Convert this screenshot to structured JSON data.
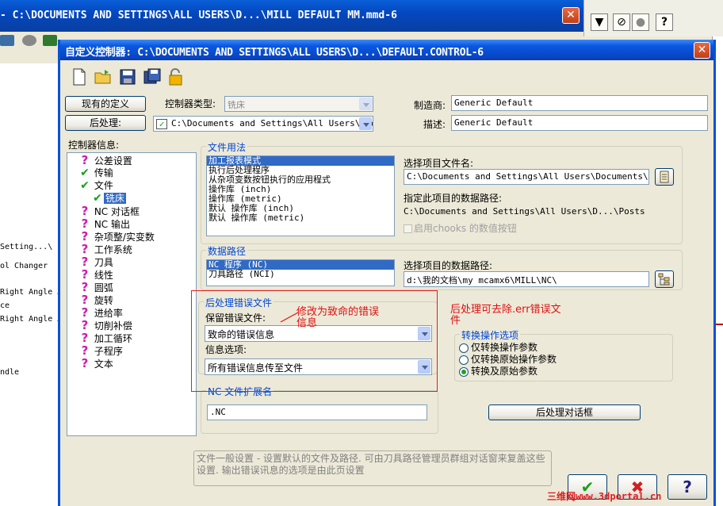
{
  "parent_window": {
    "title": "- C:\\DOCUMENTS AND SETTINGS\\ALL USERS\\D...\\MILL DEFAULT MM.mmd-6",
    "close": "✕",
    "left_lines": [
      "Setting...\\",
      "ol Changer",
      "Right Angle A",
      "ce",
      "Right Angle A",
      "ndle"
    ],
    "right_toolbar_icons": [
      "▼",
      "⊘",
      "●",
      "?"
    ]
  },
  "dialog": {
    "title": "自定义控制器: C:\\DOCUMENTS AND SETTINGS\\ALL USERS\\D...\\DEFAULT.CONTROL-6",
    "close": "✕",
    "toolbar_icons": [
      "new-file-icon",
      "open-folder-icon",
      "save-icon",
      "save-as-icon",
      "lock-icon"
    ],
    "btn_existing": "现有的定义",
    "btn_post": "后处理:",
    "controller_type_label": "控制器类型:",
    "controller_type_value": "铣床",
    "post_path": "C:\\Documents and Settings\\All Users\\Docu",
    "manufacturer_label": "制造商:",
    "manufacturer_value": "Generic Default",
    "description_label": "描述:",
    "description_value": "Generic Default",
    "tree_label": "控制器信息:",
    "tree": [
      {
        "mark": "?",
        "label": "公差设置"
      },
      {
        "mark": "✔",
        "label": "传输"
      },
      {
        "mark": "✔",
        "label": "文件"
      },
      {
        "mark": "✔",
        "label": "铣床",
        "child": true
      },
      {
        "mark": "?",
        "label": "NC 对话框"
      },
      {
        "mark": "?",
        "label": "NC 输出"
      },
      {
        "mark": "?",
        "label": "杂项整/实变数"
      },
      {
        "mark": "?",
        "label": "工作系统"
      },
      {
        "mark": "?",
        "label": "刀具"
      },
      {
        "mark": "?",
        "label": "线性"
      },
      {
        "mark": "?",
        "label": "圆弧"
      },
      {
        "mark": "?",
        "label": "旋转"
      },
      {
        "mark": "?",
        "label": "进给率"
      },
      {
        "mark": "?",
        "label": "切削补偿"
      },
      {
        "mark": "?",
        "label": "加工循环"
      },
      {
        "mark": "?",
        "label": "子程序"
      },
      {
        "mark": "?",
        "label": "文本"
      }
    ],
    "file_usage": {
      "title": "文件用法",
      "items": [
        "加工报表模式",
        "执行后处理程序",
        "从杂项变数按钮执行的应用程式",
        "操作库 (inch)",
        "操作库 (metric)",
        "默认 操作库 (inch)",
        "默认 操作库 (metric)"
      ],
      "select_file_label": "选择项目文件名:",
      "select_file_value": "C:\\Documents and Settings\\All Users\\Documents\\share",
      "data_path_label": "指定此项目的数据路径:",
      "data_path_value": "C:\\Documents and Settings\\All Users\\D...\\Posts",
      "chooks_label": "启用chooks 的数值按钮"
    },
    "data_path": {
      "title": "数据路径",
      "items": [
        "NC 程序 (NC)",
        "刀具路径 (NCI)"
      ],
      "select_path_label": "选择项目的数据路径:",
      "select_path_value": "d:\\我的文档\\my mcamx6\\MILL\\NC\\"
    },
    "post_error": {
      "title": "后处理错误文件",
      "keep_label": "保留错误文件:",
      "keep_value": "致命的错误信息",
      "info_label": "信息选项:",
      "info_value": "所有错误信息传至文件"
    },
    "convert_ops": {
      "title": "转换操作选项",
      "options": [
        "仅转换操作参数",
        "仅转换原始操作参数",
        "转换及原始参数"
      ],
      "selected": 2
    },
    "nc_ext": {
      "title": "NC 文件扩展名",
      "value": ".NC"
    },
    "post_dialog_button": "后处理对话框",
    "help_text": "文件一般设置 - 设置默认的文件及路径. 可由刀具路径管理员群组对话窗来复盖这些设置. 输出错误讯息的选项是由此页设置",
    "btn_ok": "✔",
    "btn_cancel": "✖",
    "btn_help": "?"
  },
  "annotations": {
    "note1_line1": "修改为致命的错误",
    "note1_line2": "信息",
    "note2_line1": "后处理可去除.err错误文",
    "note2_line2": "件"
  },
  "watermark": "三维网www.3dportal.cn",
  "colors": {
    "title_blue": "#0a58e0",
    "group_title": "#0046d5",
    "annotation_red": "#e01010",
    "selection": "#316ac5"
  }
}
